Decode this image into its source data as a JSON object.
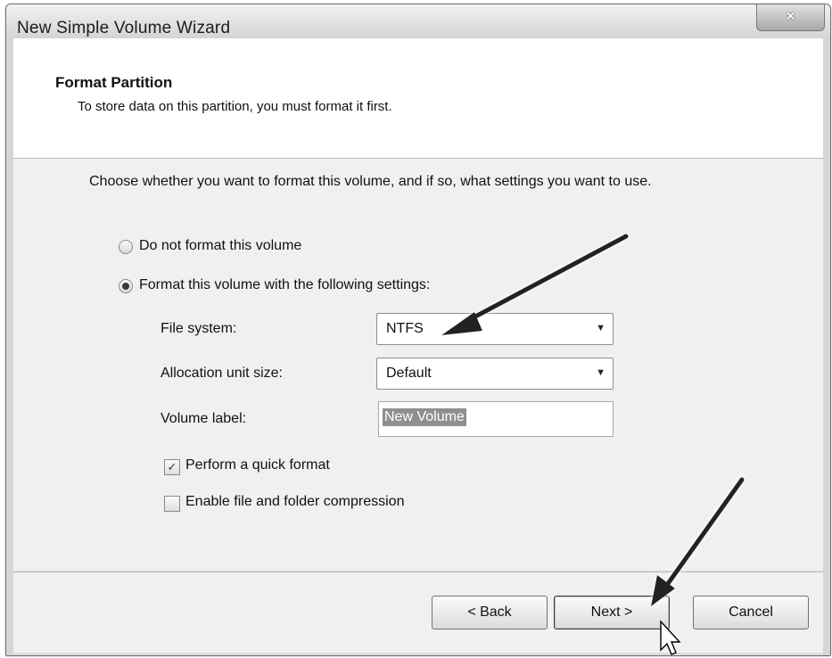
{
  "window": {
    "title": "New Simple Volume Wizard",
    "close_symbol": "×"
  },
  "header": {
    "title": "Format Partition",
    "subtitle": "To store data on this partition, you must format it first."
  },
  "content": {
    "instruction": "Choose whether you want to format this volume, and if so, what settings you want to use.",
    "options": [
      {
        "label": "Do not format this volume",
        "selected": false
      },
      {
        "label": "Format this volume with the following settings:",
        "selected": true
      }
    ],
    "file_system": {
      "label": "File system:",
      "value": "NTFS"
    },
    "allocation_unit_size": {
      "label": "Allocation unit size:",
      "value": "Default"
    },
    "volume_label": {
      "label": "Volume label:",
      "value": "New Volume"
    },
    "quick_format": {
      "label": "Perform a quick format",
      "checked": true,
      "mark": "✓"
    },
    "compression": {
      "label": "Enable file and folder compression",
      "checked": false
    }
  },
  "buttons": {
    "back": "< Back",
    "next": "Next >",
    "cancel": "Cancel"
  },
  "icons": {
    "dropdown_arrow": "▼"
  }
}
